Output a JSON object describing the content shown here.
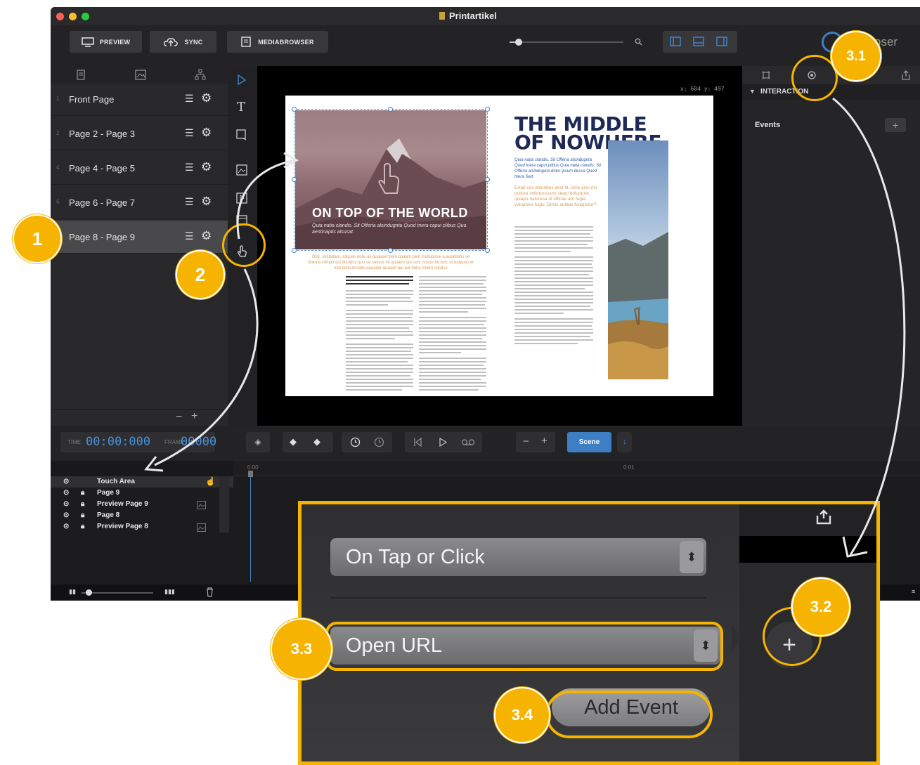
{
  "window": {
    "title": "Printartikel",
    "brand_suffix": "oser"
  },
  "toolbar": {
    "preview_label": "PREVIEW",
    "sync_label": "SYNC",
    "mediabrowser_label": "MEDIABROWSER",
    "zoom_level": 0.08
  },
  "pages": {
    "items": [
      {
        "num": "1",
        "label": "Front Page"
      },
      {
        "num": "2",
        "label": "Page 2 - Page 3"
      },
      {
        "num": "4",
        "label": "Page 4 - Page 5"
      },
      {
        "num": "6",
        "label": "Page 6 - Page 7"
      },
      {
        "num": "8",
        "label": "Page 8 - Page 9"
      }
    ],
    "footer_minus": "−",
    "footer_plus": "+"
  },
  "canvas": {
    "coords": "x: 604 y: 497",
    "hero_title": "ON TOP OF THE WORLD",
    "hero_script": "Quia natia clandis. Sit Offeria alsindugnta Quod tnera capui plibus Qua aentinaptis alsusat.",
    "headline_1": "THE MIDDLE",
    "headline_2": "OF NOWHERE",
    "headline_script": "Quia natia clandis. Sit Offeria alsindugnta Quod tnera capui plibus Quia natia clandis. Sit Offeria alsindugnta dolor ipsum dessa Quod tnera Sed",
    "intro_orange": "Errati cus doloribus dest lit, sime juss mir pullore vollorpossum sequi dolupture, quiapo naturesa di officae am fugia volupture fugiu. Dimis auldas fungnotur?",
    "caption_orange": "Obit, volupitam, aliquas dolla as quasper peni quaam pedi mollupisse a autafastis se doluria volupit qui blandus quo se samus mi quiaerit qui sunt nosuo hit ovo, ut eaquias et inet dolla dictatis quasper quaasit qui aut dolut volerit solutus"
  },
  "interaction_panel": {
    "section_label": "INTERACTION",
    "events_label": "Events",
    "add_label": "+"
  },
  "transport": {
    "time_label": "TIME",
    "time_value": "00:00:000",
    "frame_label": "FRAME",
    "frame_value": "00000",
    "scene_label": "Scene",
    "minus": "−",
    "plus": "+"
  },
  "timeline": {
    "ruler_start": "0:00",
    "ruler_mark": "0:01",
    "layers": [
      {
        "name": "Touch Area",
        "locked": false
      },
      {
        "name": "Page 9",
        "locked": true
      },
      {
        "name": "Preview Page 9",
        "locked": true
      },
      {
        "name": "Page 8",
        "locked": true
      },
      {
        "name": "Preview Page 8",
        "locked": true
      }
    ]
  },
  "callout": {
    "trigger": "On Tap or Click",
    "action": "Open URL",
    "add_event": "Add Event",
    "plus": "+"
  },
  "badges": {
    "b1": "1",
    "b2": "2",
    "b31": "3.1",
    "b32": "3.2",
    "b33": "3.3",
    "b34": "3.4"
  },
  "colors": {
    "accent": "#f6b400",
    "blue": "#3d7fc4",
    "navy": "#1e2a55",
    "orange_text": "#d89b5a"
  }
}
